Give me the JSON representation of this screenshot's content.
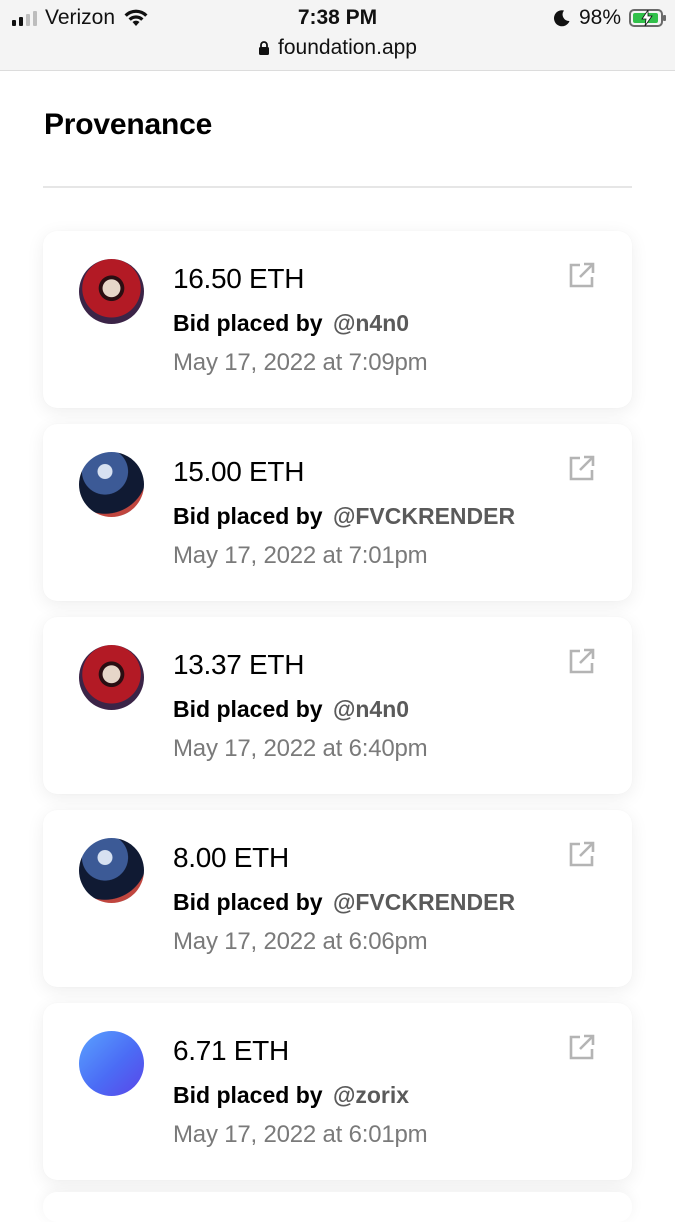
{
  "status_bar": {
    "carrier": "Verizon",
    "time": "7:38 PM",
    "battery_percent": "98%",
    "signal_bars": 2,
    "icons": [
      "signal-icon",
      "wifi-icon",
      "moon-icon",
      "battery-charging-icon"
    ]
  },
  "browser": {
    "url": "foundation.app",
    "lock_icon": "lock-icon"
  },
  "page": {
    "section_title": "Provenance"
  },
  "bids": [
    {
      "amount": "16.50 ETH",
      "label": "Bid placed by",
      "user": "@n4n0",
      "date": "May 17, 2022 at 7:09pm",
      "avatar": "skull"
    },
    {
      "amount": "15.00 ETH",
      "label": "Bid placed by",
      "user": "@FVCKRENDER",
      "date": "May 17, 2022 at 7:01pm",
      "avatar": "render"
    },
    {
      "amount": "13.37 ETH",
      "label": "Bid placed by",
      "user": "@n4n0",
      "date": "May 17, 2022 at 6:40pm",
      "avatar": "skull"
    },
    {
      "amount": "8.00 ETH",
      "label": "Bid placed by",
      "user": "@FVCKRENDER",
      "date": "May 17, 2022 at 6:06pm",
      "avatar": "render"
    },
    {
      "amount": "6.71 ETH",
      "label": "Bid placed by",
      "user": "@zorix",
      "date": "May 17, 2022 at 6:01pm",
      "avatar": "blue"
    }
  ],
  "colors": {
    "accent_battery": "#31c04a",
    "muted_text": "#7a7a7a",
    "username_text": "#5a5a5a"
  }
}
